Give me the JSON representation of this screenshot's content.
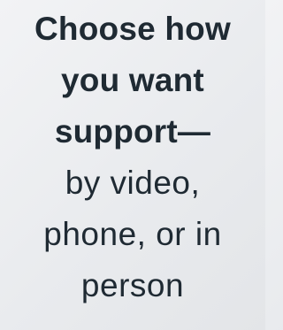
{
  "card": {
    "headline_lines": [
      "Choose how",
      "you want",
      "support—"
    ],
    "subline_lines": [
      "by video,",
      "phone, or in",
      "person"
    ]
  }
}
